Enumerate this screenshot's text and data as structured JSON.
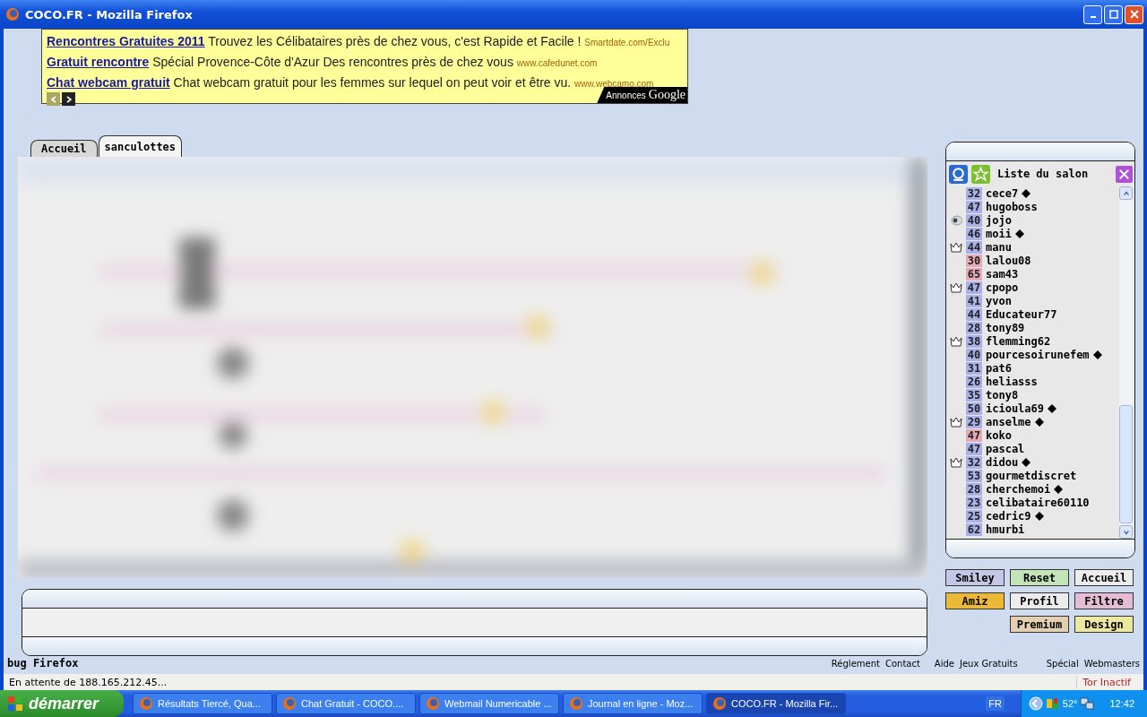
{
  "window": {
    "title": "COCO.FR - Mozilla Firefox"
  },
  "ads": {
    "items": [
      {
        "title": "Rencontres Gratuites 2011",
        "text": "Trouvez les Célibataires près de chez vous, c'est Rapide et Facile !",
        "url": "Smartdate.com/Exclu"
      },
      {
        "title": "Gratuit rencontre",
        "text": "Spécial Provence-Côte d'Azur Des rencontres près de chez vous",
        "url": "www.cafedunet.com"
      },
      {
        "title": "Chat webcam gratuit",
        "text": "Chat webcam gratuit pour les femmes sur lequel on peut voir et être vu.",
        "url": "www.webcamo.com"
      }
    ],
    "prev": {
      "disabled": true
    },
    "next": {
      "disabled": false
    },
    "badge": {
      "label": "Annonces",
      "brand": "Google"
    }
  },
  "tabs": [
    {
      "label": "Accueil",
      "selected": false
    },
    {
      "label": "sanculottes",
      "selected": true
    }
  ],
  "user_list": {
    "title": "Liste du salon",
    "users": [
      {
        "age": "32",
        "name": "cece7",
        "color": "#aab0e8",
        "kind": "plain",
        "diamond": true
      },
      {
        "age": "47",
        "name": "hugoboss",
        "color": "#aab0e8",
        "kind": "plain",
        "diamond": false
      },
      {
        "age": "40",
        "name": "jojo",
        "color": "#aab0e8",
        "kind": "webcam",
        "diamond": false
      },
      {
        "age": "46",
        "name": "moii",
        "color": "#aab0e8",
        "kind": "plain",
        "diamond": true
      },
      {
        "age": "44",
        "name": "manu",
        "color": "#aab0e8",
        "kind": "crown",
        "diamond": false
      },
      {
        "age": "30",
        "name": "lalou08",
        "color": "#e8aab8",
        "kind": "plain",
        "diamond": false
      },
      {
        "age": "65",
        "name": "sam43",
        "color": "#e8aab8",
        "kind": "plain",
        "diamond": false
      },
      {
        "age": "47",
        "name": "cpopo",
        "color": "#aab0e8",
        "kind": "crown",
        "diamond": false
      },
      {
        "age": "41",
        "name": "yvon",
        "color": "#aab0e8",
        "kind": "plain",
        "diamond": false
      },
      {
        "age": "44",
        "name": "Educateur77",
        "color": "#aab0e8",
        "kind": "plain",
        "diamond": false
      },
      {
        "age": "28",
        "name": "tony89",
        "color": "#aab0e8",
        "kind": "plain",
        "diamond": false
      },
      {
        "age": "38",
        "name": "flemming62",
        "color": "#aab0e8",
        "kind": "crown",
        "diamond": false
      },
      {
        "age": "40",
        "name": "pourcesoirunefem",
        "color": "#aab0e8",
        "kind": "plain",
        "diamond": true
      },
      {
        "age": "31",
        "name": "pat6",
        "color": "#aab0e8",
        "kind": "plain",
        "diamond": false
      },
      {
        "age": "26",
        "name": "heliasss",
        "color": "#aab0e8",
        "kind": "plain",
        "diamond": false
      },
      {
        "age": "35",
        "name": "tony8",
        "color": "#aab0e8",
        "kind": "plain",
        "diamond": false
      },
      {
        "age": "50",
        "name": "icioula69",
        "color": "#aab0e8",
        "kind": "plain",
        "diamond": true
      },
      {
        "age": "29",
        "name": "anselme",
        "color": "#aab0e8",
        "kind": "crown",
        "diamond": true
      },
      {
        "age": "47",
        "name": "koko",
        "color": "#e8aab8",
        "kind": "plain",
        "diamond": false
      },
      {
        "age": "47",
        "name": "pascal",
        "color": "#aab0e8",
        "kind": "plain",
        "diamond": false
      },
      {
        "age": "32",
        "name": "didou",
        "color": "#aab0e8",
        "kind": "crown",
        "diamond": true
      },
      {
        "age": "53",
        "name": "gourmetdiscret",
        "color": "#aab0e8",
        "kind": "plain",
        "diamond": false
      },
      {
        "age": "28",
        "name": "cherchemoi",
        "color": "#aab0e8",
        "kind": "plain",
        "diamond": true
      },
      {
        "age": "23",
        "name": "celibataire60110",
        "color": "#aab0e8",
        "kind": "plain",
        "diamond": false
      },
      {
        "age": "25",
        "name": "cedric9",
        "color": "#aab0e8",
        "kind": "plain",
        "diamond": true
      },
      {
        "age": "62",
        "name": "hmurbi",
        "color": "#aab0e8",
        "kind": "plain",
        "diamond": false
      }
    ]
  },
  "buttons": [
    {
      "label": "Smiley",
      "color": "#c4c8e4"
    },
    {
      "label": "Reset",
      "color": "#c4e4b8"
    },
    {
      "label": "Accueil",
      "color": "#ececec"
    },
    {
      "label": "Amiz",
      "color": "#ecb838"
    },
    {
      "label": "Profil",
      "color": "#ececec"
    },
    {
      "label": "Filtre",
      "color": "#e4bcd4"
    },
    {
      "label": "Premium",
      "color": "#e4d0b0"
    },
    {
      "label": "Design",
      "color": "#ece8a0"
    }
  ],
  "bug_note": "bug Firefox",
  "footer_links": [
    "Réglement",
    "Contact",
    "Aide",
    "Jeux Gratuits",
    "Spécial",
    "Webmasters"
  ],
  "status_bar": {
    "text": "En attente de 188.165.212.45...",
    "tor": "Tor Inactif"
  },
  "taskbar": {
    "start": "démarrer",
    "items": [
      {
        "label": "Résultats Tiercé, Qua...",
        "selected": false
      },
      {
        "label": "Chat Gratuit - COCO....",
        "selected": false
      },
      {
        "label": "Webmail Numericable ...",
        "selected": false
      },
      {
        "label": "Journal en ligne - Moz...",
        "selected": false
      },
      {
        "label": "COCO.FR - Mozilla Fir...",
        "selected": true
      }
    ],
    "language": "FR",
    "temperature": "52°",
    "clock": "12:42"
  }
}
